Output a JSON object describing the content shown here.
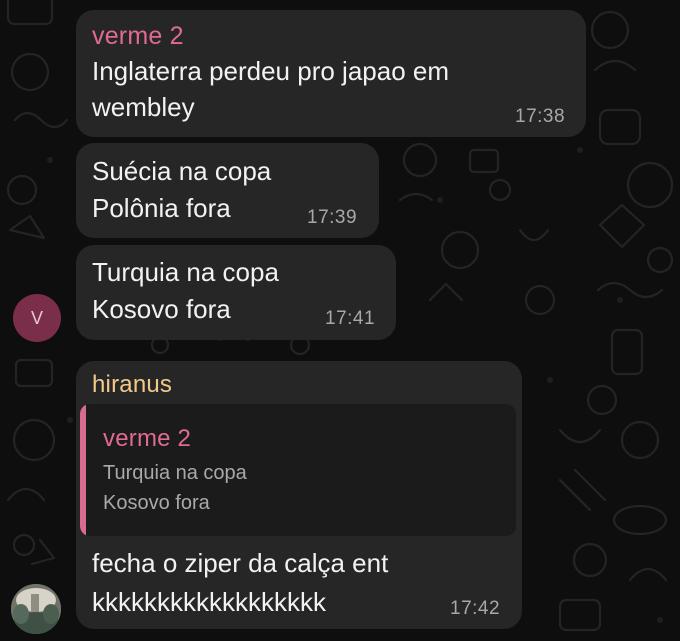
{
  "messages": [
    {
      "sender": "verme 2",
      "lines": [
        "Inglaterra perdeu pro japao em",
        "wembley"
      ],
      "time": "17:38"
    },
    {
      "lines": [
        "Suécia na copa",
        "Polônia fora"
      ],
      "time": "17:39"
    },
    {
      "lines": [
        "Turquia na copa",
        "Kosovo fora"
      ],
      "time": "17:41"
    },
    {
      "sender": "hiranus",
      "reply": {
        "sender": "verme 2",
        "lines": [
          "Turquia na copa",
          "Kosovo fora"
        ]
      },
      "lines": [
        "fecha o ziper da calça ent",
        "kkkkkkkkkkkkkkkkkk"
      ],
      "time": "17:42"
    }
  ],
  "avatars": {
    "verme2_initial": "V"
  },
  "colors": {
    "verme2_name": "#e06a92",
    "hiranus_name": "#f3c98b",
    "bubble_bg": "#262626",
    "chat_bg": "#0e0e0e",
    "avatar_v_bg": "#7a2e49"
  }
}
